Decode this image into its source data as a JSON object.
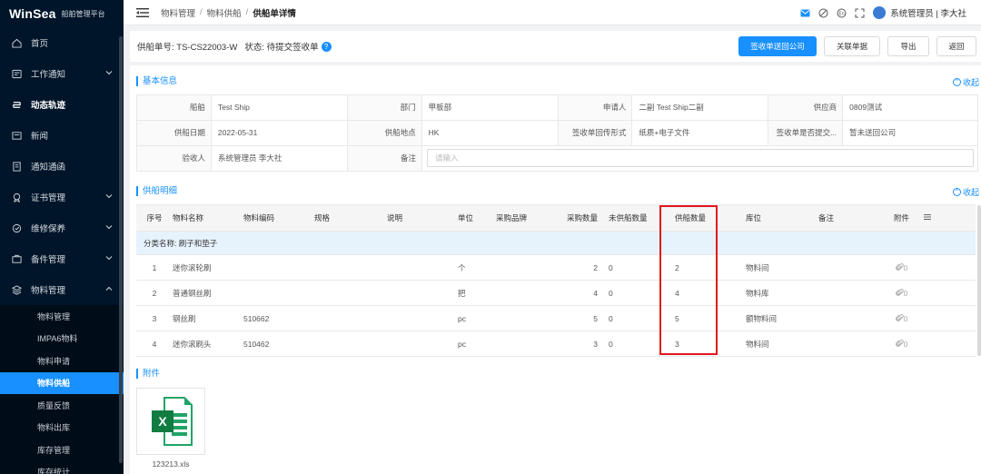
{
  "brand": {
    "logo": "WinSea",
    "subtitle": "船舶管理平台"
  },
  "sidebar": {
    "items": [
      {
        "label": "首页",
        "icon": "home-icon",
        "has_children": false,
        "bold": false
      },
      {
        "label": "工作通知",
        "icon": "notice-icon",
        "has_children": true,
        "bold": false
      },
      {
        "label": "动态轨迹",
        "icon": "track-icon",
        "has_children": false,
        "bold": true
      },
      {
        "label": "新闻",
        "icon": "news-icon",
        "has_children": false,
        "bold": false
      },
      {
        "label": "通知通函",
        "icon": "circular-icon",
        "has_children": false,
        "bold": false
      },
      {
        "label": "证书管理",
        "icon": "certificate-icon",
        "has_children": true,
        "bold": false
      },
      {
        "label": "维修保养",
        "icon": "maintenance-icon",
        "has_children": true,
        "bold": false
      },
      {
        "label": "备件管理",
        "icon": "spare-parts-icon",
        "has_children": true,
        "bold": false
      },
      {
        "label": "物料管理",
        "icon": "materials-icon",
        "has_children": true,
        "bold": false,
        "expanded": true
      }
    ],
    "sub_items": [
      {
        "label": "物料管理",
        "active": false
      },
      {
        "label": "IMPA6物料",
        "active": false
      },
      {
        "label": "物料申请",
        "active": false
      },
      {
        "label": "物料供船",
        "active": true
      },
      {
        "label": "质量反馈",
        "active": false
      },
      {
        "label": "物料出库",
        "active": false
      },
      {
        "label": "库存管理",
        "active": false
      },
      {
        "label": "库存统计",
        "active": false
      }
    ]
  },
  "header": {
    "breadcrumb": [
      "物料管理",
      "物料供船",
      "供船单详情"
    ],
    "user": "系统管理员 | 李大社"
  },
  "doc": {
    "number_label": "供船单号: TS-CS22003-W",
    "status_label": "状态: 待提交签收单",
    "buttons": {
      "sign_return": "签收单送回公司",
      "link_doc": "关联单据",
      "export": "导出",
      "back": "返回"
    }
  },
  "basic_info": {
    "title": "基本信息",
    "collapse": "收起",
    "rows": [
      [
        {
          "label": "船舶",
          "value": "Test Ship"
        },
        {
          "label": "部门",
          "value": "甲板部"
        },
        {
          "label": "申请人",
          "value": "二副 Test Ship二副"
        },
        {
          "label": "供应商",
          "value": "0809测试"
        }
      ],
      [
        {
          "label": "供船日期",
          "value": "2022-05-31"
        },
        {
          "label": "供船地点",
          "value": "HK"
        },
        {
          "label": "签收单回传形式",
          "value": "纸质+电子文件"
        },
        {
          "label": "签收单是否提交...",
          "value": "暂未送回公司"
        }
      ]
    ],
    "receiver_label": "验收人",
    "receiver_value": "系统管理员 李大社",
    "remark_label": "备注",
    "remark_placeholder": "请输入"
  },
  "detail": {
    "title": "供船明细",
    "collapse": "收起",
    "columns": {
      "seq": "序号",
      "name": "物料名称",
      "code": "物料编码",
      "spec": "规格",
      "desc": "说明",
      "unit": "单位",
      "brand": "采购品牌",
      "qty": "采购数量",
      "unsupplied": "未供船数量",
      "supplied": "供船数量",
      "location": "库位",
      "remark": "备注",
      "attachment": "附件"
    },
    "group_label": "分类名称:  刷子和垫子",
    "rows": [
      {
        "seq": "1",
        "name": "迷你滚轮刷",
        "code": "",
        "spec": "",
        "desc": "",
        "unit": "个",
        "brand": "",
        "qty": "2",
        "unsupplied": "0",
        "supplied": "2",
        "location": "物料间",
        "remark": "",
        "attachment": "0"
      },
      {
        "seq": "2",
        "name": "普通钢丝刷",
        "code": "",
        "spec": "",
        "desc": "",
        "unit": "把",
        "brand": "",
        "qty": "4",
        "unsupplied": "0",
        "supplied": "4",
        "location": "物料库",
        "remark": "",
        "attachment": "0"
      },
      {
        "seq": "3",
        "name": "钢丝刷",
        "code": "510662",
        "spec": "",
        "desc": "",
        "unit": "pc",
        "brand": "",
        "qty": "5",
        "unsupplied": "0",
        "supplied": "5",
        "location": "额物料间",
        "remark": "",
        "attachment": "0"
      },
      {
        "seq": "4",
        "name": "迷你滚刷头",
        "code": "510462",
        "spec": "",
        "desc": "",
        "unit": "pc",
        "brand": "",
        "qty": "3",
        "unsupplied": "0",
        "supplied": "3",
        "location": "物料间",
        "remark": "",
        "attachment": "0"
      }
    ]
  },
  "attachments": {
    "title": "附件",
    "files": [
      {
        "name": "123213.xls",
        "icon": "excel-file-icon"
      }
    ]
  },
  "colors": {
    "primary": "#1890ff",
    "sidebar_bg": "#001529",
    "highlight": "#e0181d"
  }
}
